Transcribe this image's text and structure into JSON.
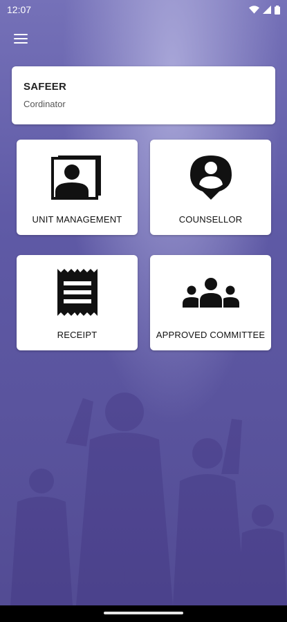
{
  "status": {
    "time": "12:07",
    "icons": [
      "wifi-icon",
      "signal-icon",
      "battery-icon"
    ]
  },
  "appbar": {
    "menu_icon": "menu-icon"
  },
  "profile": {
    "name": "SAFEER",
    "role": "Cordinator"
  },
  "tiles": [
    {
      "label": "UNIT MANAGEMENT",
      "icon": "contact-card-icon"
    },
    {
      "label": "COUNSELLOR",
      "icon": "person-pin-icon"
    },
    {
      "label": "RECEIPT",
      "icon": "receipt-icon"
    },
    {
      "label": "APPROVED COMMITTEE",
      "icon": "group-icon"
    }
  ],
  "colors": {
    "background": "#5b56a0",
    "card": "#ffffff",
    "icon": "#111111"
  }
}
